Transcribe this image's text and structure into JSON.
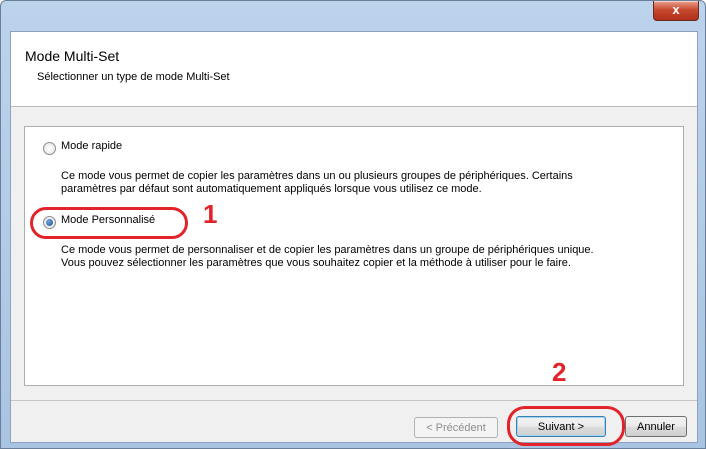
{
  "window": {
    "title": "",
    "close_label": "x"
  },
  "header": {
    "title": "Mode Multi-Set",
    "subtitle": "Sélectionner un type de mode Multi-Set"
  },
  "options": [
    {
      "label": "Mode rapide",
      "selected": false,
      "description_lines": [
        "Ce mode vous permet de copier les paramètres dans un ou plusieurs groupes de périphériques. Certains",
        "paramètres par défaut sont automatiquement appliqués lorsque vous utilisez ce mode."
      ]
    },
    {
      "label": "Mode Personnalisé",
      "selected": true,
      "description_lines": [
        "Ce mode vous permet de personnaliser et de copier les paramètres dans un groupe de périphériques unique.",
        "Vous pouvez sélectionner les paramètres que vous souhaitez copier et la méthode à utiliser pour le faire."
      ]
    }
  ],
  "callouts": {
    "one": "1",
    "two": "2",
    "color": "#e2232a"
  },
  "buttons": {
    "previous": "< Précédent",
    "next": "Suivant >",
    "cancel": "Annuler"
  }
}
